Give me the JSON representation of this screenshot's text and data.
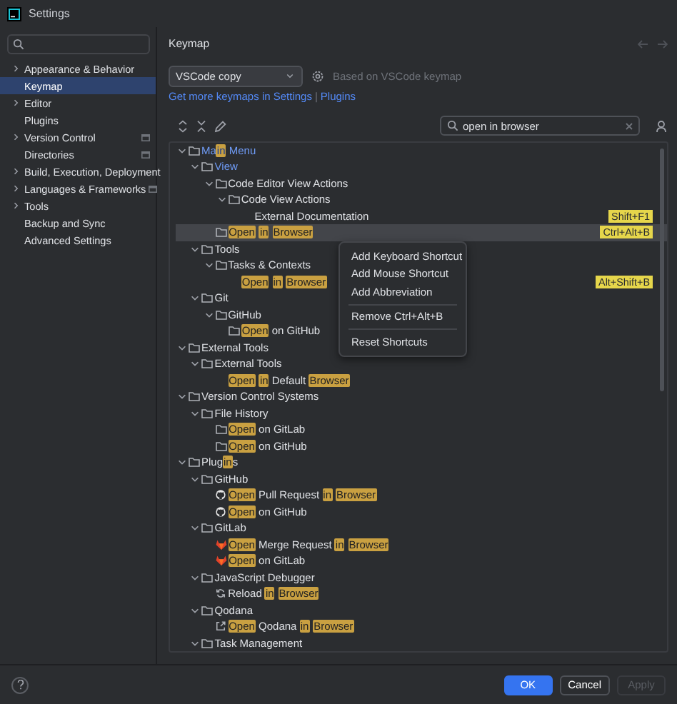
{
  "window": {
    "title": "Settings"
  },
  "sidebar": {
    "items": [
      {
        "label": "Appearance & Behavior",
        "expandable": true,
        "selected": false,
        "project_scoped": false
      },
      {
        "label": "Keymap",
        "expandable": false,
        "selected": true,
        "project_scoped": false
      },
      {
        "label": "Editor",
        "expandable": true,
        "selected": false,
        "project_scoped": false
      },
      {
        "label": "Plugins",
        "expandable": false,
        "selected": false,
        "project_scoped": false
      },
      {
        "label": "Version Control",
        "expandable": true,
        "selected": false,
        "project_scoped": true
      },
      {
        "label": "Directories",
        "expandable": false,
        "selected": false,
        "project_scoped": true
      },
      {
        "label": "Build, Execution, Deployment",
        "expandable": true,
        "selected": false,
        "project_scoped": false
      },
      {
        "label": "Languages & Frameworks",
        "expandable": true,
        "selected": false,
        "project_scoped": true
      },
      {
        "label": "Tools",
        "expandable": true,
        "selected": false,
        "project_scoped": false
      },
      {
        "label": "Backup and Sync",
        "expandable": false,
        "selected": false,
        "project_scoped": false
      },
      {
        "label": "Advanced Settings",
        "expandable": false,
        "selected": false,
        "project_scoped": false
      }
    ]
  },
  "page": {
    "title": "Keymap",
    "keymap": "VSCode copy",
    "based_on": "Based on VSCode keymap",
    "links": [
      "Get more keymaps in Settings",
      "|",
      "Plugins"
    ],
    "search": {
      "value": "open in browser"
    }
  },
  "tree": [
    {
      "kind": "group",
      "modified": true,
      "selected": false,
      "expanded": true,
      "label": [
        {
          "text": "Ma",
          "match": false
        },
        {
          "text": "in",
          "match": true
        },
        {
          "text": " Menu",
          "match": false
        }
      ],
      "children": [
        {
          "kind": "group",
          "modified": true,
          "selected": false,
          "expanded": true,
          "label": [
            {
              "text": "View",
              "match": false
            }
          ],
          "children": [
            {
              "kind": "group",
              "modified": false,
              "selected": false,
              "expanded": true,
              "label": [
                {
                  "text": "Code Editor View Actions",
                  "match": false
                }
              ],
              "children": [
                {
                  "kind": "group",
                  "modified": false,
                  "selected": false,
                  "expanded": true,
                  "label": [
                    {
                      "text": "Code View Actions",
                      "match": false
                    }
                  ],
                  "children": [
                    {
                      "kind": "action",
                      "modified": false,
                      "selected": false,
                      "label": [
                        {
                          "text": "External Documentation",
                          "match": false
                        }
                      ],
                      "shortcut": "Shift+F1"
                    }
                  ]
                }
              ]
            },
            {
              "kind": "group",
              "modified": false,
              "selected": true,
              "label": [
                {
                  "text": "Open",
                  "match": true
                },
                {
                  "text": "in",
                  "match": true
                },
                {
                  "text": "Browser",
                  "match": true
                }
              ],
              "shortcut": "Ctrl+Alt+B"
            }
          ]
        },
        {
          "kind": "group",
          "modified": false,
          "selected": false,
          "expanded": true,
          "label": [
            {
              "text": "Tools",
              "match": false
            }
          ],
          "children": [
            {
              "kind": "group",
              "modified": false,
              "selected": false,
              "expanded": true,
              "label": [
                {
                  "text": "Tasks & Contexts",
                  "match": false
                }
              ],
              "children": [
                {
                  "kind": "action",
                  "modified": false,
                  "selected": false,
                  "label": [
                    {
                      "text": "Open",
                      "match": true
                    },
                    {
                      "text": "in",
                      "match": true
                    },
                    {
                      "text": "Browser",
                      "match": true
                    }
                  ],
                  "shortcut": "Alt+Shift+B"
                }
              ]
            }
          ]
        },
        {
          "kind": "group",
          "modified": false,
          "selected": false,
          "expanded": true,
          "label": [
            {
              "text": "Git",
              "match": false
            }
          ],
          "children": [
            {
              "kind": "group",
              "modified": false,
              "selected": false,
              "expanded": true,
              "label": [
                {
                  "text": "GitHub",
                  "match": false
                }
              ],
              "children": [
                {
                  "kind": "group",
                  "modified": false,
                  "selected": false,
                  "label": [
                    {
                      "text": "Open",
                      "match": true
                    },
                    {
                      "text": " on GitHub",
                      "match": false
                    }
                  ]
                }
              ]
            }
          ]
        }
      ]
    },
    {
      "kind": "group",
      "modified": false,
      "selected": false,
      "expanded": true,
      "label": [
        {
          "text": "External Tools",
          "match": false
        }
      ],
      "children": [
        {
          "kind": "group",
          "modified": false,
          "selected": false,
          "expanded": true,
          "label": [
            {
              "text": "External Tools",
              "match": false
            }
          ],
          "children": [
            {
              "kind": "action",
              "modified": false,
              "selected": false,
              "label": [
                {
                  "text": "Open",
                  "match": true
                },
                {
                  "text": "in",
                  "match": true
                },
                {
                  "text": " Default ",
                  "match": false
                },
                {
                  "text": "Browser",
                  "match": true
                }
              ]
            }
          ]
        }
      ]
    },
    {
      "kind": "group",
      "modified": false,
      "selected": false,
      "expanded": true,
      "label": [
        {
          "text": "Version Control Systems",
          "match": false
        }
      ],
      "children": [
        {
          "kind": "group",
          "modified": false,
          "selected": false,
          "expanded": true,
          "label": [
            {
              "text": "File History",
              "match": false
            }
          ],
          "children": [
            {
              "kind": "group",
              "modified": false,
              "selected": false,
              "label": [
                {
                  "text": "Open",
                  "match": true
                },
                {
                  "text": " on GitLab",
                  "match": false
                }
              ]
            },
            {
              "kind": "group",
              "modified": false,
              "selected": false,
              "label": [
                {
                  "text": "Open",
                  "match": true
                },
                {
                  "text": " on GitHub",
                  "match": false
                }
              ]
            }
          ]
        }
      ]
    },
    {
      "kind": "group",
      "modified": false,
      "selected": false,
      "expanded": true,
      "label": [
        {
          "text": "Plug",
          "match": false
        },
        {
          "text": "in",
          "match": true
        },
        {
          "text": "s",
          "match": false
        }
      ],
      "children": [
        {
          "kind": "group",
          "modified": false,
          "selected": false,
          "expanded": true,
          "label": [
            {
              "text": "GitHub",
              "match": false
            }
          ],
          "children": [
            {
              "kind": "github",
              "modified": false,
              "selected": false,
              "label": [
                {
                  "text": "Open",
                  "match": true
                },
                {
                  "text": " Pull Request ",
                  "match": false
                },
                {
                  "text": "in",
                  "match": true
                },
                {
                  "text": "Browser",
                  "match": true
                }
              ]
            },
            {
              "kind": "github",
              "modified": false,
              "selected": false,
              "label": [
                {
                  "text": "Open",
                  "match": true
                },
                {
                  "text": " on GitHub",
                  "match": false
                }
              ]
            }
          ]
        },
        {
          "kind": "group",
          "modified": false,
          "selected": false,
          "expanded": true,
          "label": [
            {
              "text": "GitLab",
              "match": false
            }
          ],
          "children": [
            {
              "kind": "gitlab",
              "modified": false,
              "selected": false,
              "label": [
                {
                  "text": "Open",
                  "match": true
                },
                {
                  "text": " Merge Request ",
                  "match": false
                },
                {
                  "text": "in",
                  "match": true
                },
                {
                  "text": "Browser",
                  "match": true
                }
              ]
            },
            {
              "kind": "gitlab",
              "modified": false,
              "selected": false,
              "label": [
                {
                  "text": "Open",
                  "match": true
                },
                {
                  "text": " on GitLab",
                  "match": false
                }
              ]
            }
          ]
        },
        {
          "kind": "group",
          "modified": false,
          "selected": false,
          "expanded": true,
          "label": [
            {
              "text": "JavaScript Debugger",
              "match": false
            }
          ],
          "children": [
            {
              "kind": "reload",
              "modified": false,
              "selected": false,
              "label": [
                {
                  "text": "Reload ",
                  "match": false
                },
                {
                  "text": "in",
                  "match": true
                },
                {
                  "text": "Browser",
                  "match": true
                }
              ]
            }
          ]
        },
        {
          "kind": "group",
          "modified": false,
          "selected": false,
          "expanded": true,
          "label": [
            {
              "text": "Qodana",
              "match": false
            }
          ],
          "children": [
            {
              "kind": "external",
              "modified": false,
              "selected": false,
              "label": [
                {
                  "text": "Open",
                  "match": true
                },
                {
                  "text": " Qodana ",
                  "match": false
                },
                {
                  "text": "in",
                  "match": true
                },
                {
                  "text": "Browser",
                  "match": true
                }
              ]
            }
          ]
        },
        {
          "kind": "group",
          "modified": false,
          "selected": false,
          "expanded": true,
          "label": [
            {
              "text": "Task Management",
              "match": false
            }
          ]
        }
      ]
    }
  ],
  "context_menu": [
    {
      "kind": "item",
      "label": "Add Keyboard Shortcut"
    },
    {
      "kind": "item",
      "label": "Add Mouse Shortcut"
    },
    {
      "kind": "item",
      "label": "Add Abbreviation"
    },
    {
      "kind": "separator"
    },
    {
      "kind": "item",
      "label": "Remove Ctrl+Alt+B"
    },
    {
      "kind": "separator"
    },
    {
      "kind": "item",
      "label": "Reset Shortcuts"
    }
  ],
  "buttons": [
    {
      "label": "OK",
      "kind": "primary",
      "disabled": false
    },
    {
      "label": "Cancel",
      "kind": "normal",
      "disabled": false
    },
    {
      "label": "Apply",
      "kind": "normal",
      "disabled": true
    }
  ]
}
